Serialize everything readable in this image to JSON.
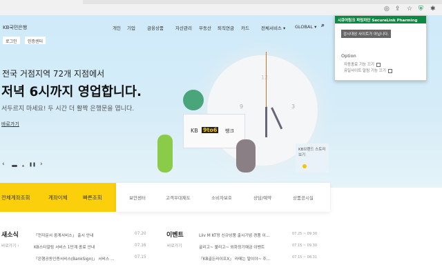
{
  "browser": {
    "extensions": [
      "eye-off-icon",
      "share-icon",
      "star-icon",
      "shield-icon",
      "puzzle-icon"
    ]
  },
  "header": {
    "logo": "KB국민은행",
    "nav": [
      "개인",
      "기업",
      "금융상품",
      "자산관리",
      "부동산",
      "퇴직연금",
      "카드",
      "전체서비스 ▾",
      "GLOBAL ▾"
    ],
    "login": "로그인",
    "cert": "인증센터"
  },
  "hero": {
    "line1": "전국 거점지역 72개 지점에서",
    "title": "저녁 6시까지 영업합니다.",
    "subtitle": "서두르지 마세요! 두 시간 더 활짝 은행문을 엽니다.",
    "link": "바로가기",
    "card_kb": "KB",
    "card_num": "9to6",
    "card_suffix": "뱅크",
    "clock": [
      "12",
      "9",
      "3"
    ],
    "story": "KB브랜드 스토리 보기"
  },
  "quick": {
    "yellow": [
      "전체계좌조회",
      "계좌이체",
      "빠른조회"
    ],
    "white": [
      "보안센터",
      "고객우대제도",
      "소비자보호",
      "상담/예약",
      "상품공시실"
    ]
  },
  "news": {
    "title": "새소식",
    "more": "바로가기 ›",
    "items": [
      {
        "text": "「전자문서 중계서비스」 출시 안내",
        "date": "07.20"
      },
      {
        "text": "KB스타알림 서비스 1단계 종료 안내",
        "date": "07.16"
      },
      {
        "text": "「은행공동인증서비스(BankSign)」 서비스 ...",
        "date": "07.15"
      }
    ]
  },
  "events": {
    "title": "이벤트",
    "more": "바로가기",
    "items": [
      {
        "text": "Liiv M KT망 신규상품 출시기념 경품 이...",
        "date": "07.25 ~ 09.30"
      },
      {
        "text": "굴리고~ 불리고~ 외화정기예금 이벤트",
        "date": "07.15 ~ 09.30"
      },
      {
        "text": "「KB골든라이프X」 라떼는 말이야~ 주...",
        "date": "07.15 ~ 08.31"
      }
    ]
  },
  "popup": {
    "header": "시큐어링크 파밍차단 SecureLink Pharming",
    "message": "감시대상 사이트가 아닙니다.",
    "option_title": "Option",
    "options": [
      "자동종료 기능 끄기",
      "유일사이트 알림 기능 끄기"
    ]
  },
  "colors": {
    "yellow": "#fccf0c",
    "green": "#0a8a45"
  }
}
